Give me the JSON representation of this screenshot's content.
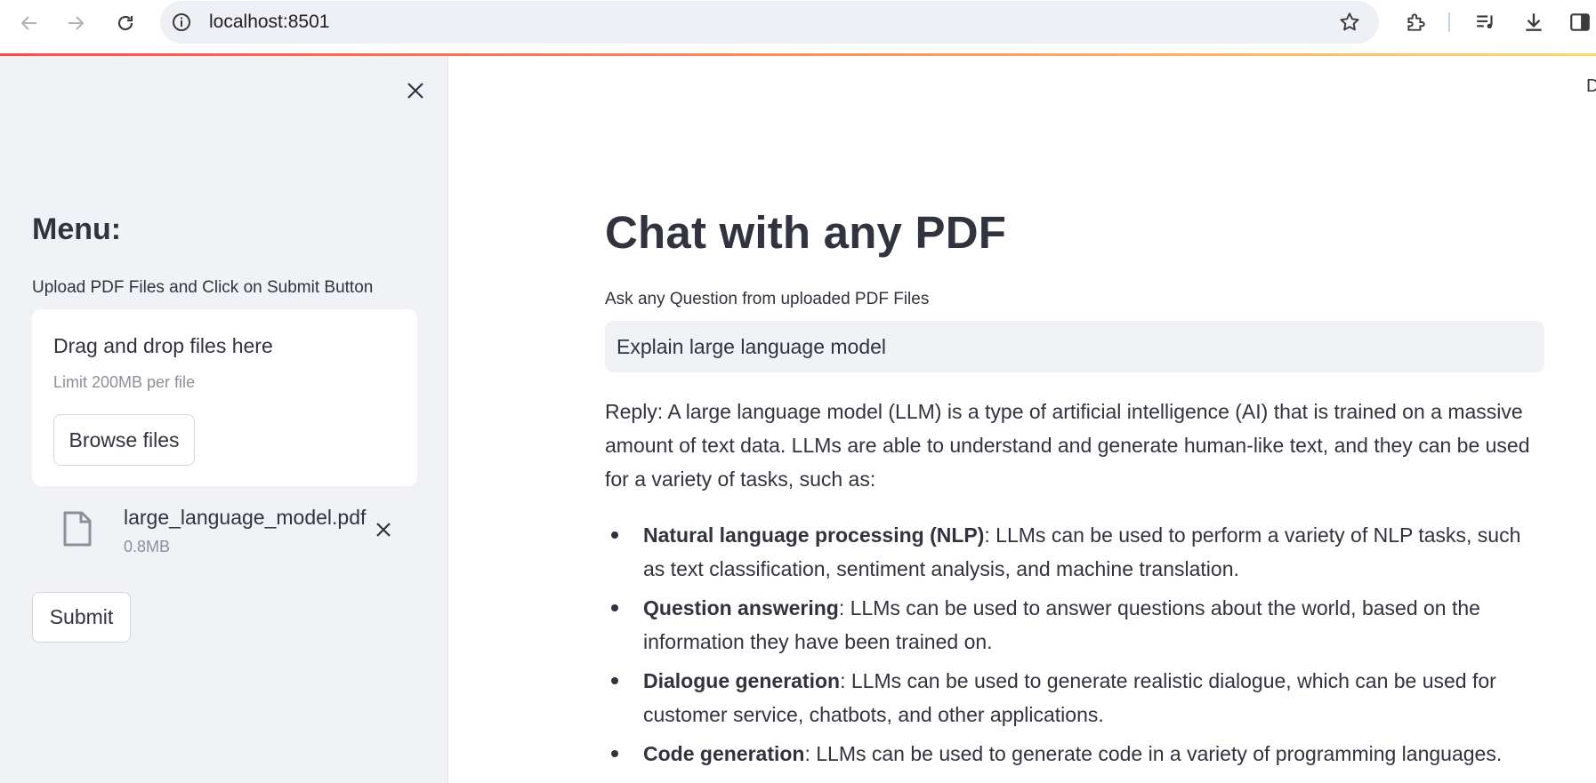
{
  "browser": {
    "url": "localhost:8501",
    "icons": [
      "back-icon",
      "forward-icon",
      "reload-icon",
      "site-info-icon",
      "bookmark-star-icon",
      "extensions-icon",
      "media-queue-icon",
      "download-icon",
      "side-panel-icon"
    ]
  },
  "sidebar": {
    "title": "Menu:",
    "upload_label": "Upload PDF Files and Click on Submit Button",
    "dropzone": {
      "title": "Drag and drop files here",
      "limit": "Limit 200MB per file",
      "browse_label": "Browse files"
    },
    "file": {
      "name": "large_language_model.pdf",
      "size": "0.8MB"
    },
    "submit_label": "Submit"
  },
  "main": {
    "corner_text": "D",
    "title": "Chat with any PDF",
    "question_label": "Ask any Question from uploaded PDF Files",
    "question_value": "Explain large language model",
    "reply": "Reply: A large language model (LLM) is a type of artificial intelligence (AI) that is trained on a massive amount of text data. LLMs are able to understand and generate human-like text, and they can be used for a variety of tasks, such as:",
    "bullets": [
      {
        "term": "Natural language processing (NLP)",
        "text": ": LLMs can be used to perform a variety of NLP tasks, such as text classification, sentiment analysis, and machine translation."
      },
      {
        "term": "Question answering",
        "text": ": LLMs can be used to answer questions about the world, based on the information they have been trained on."
      },
      {
        "term": "Dialogue generation",
        "text": ": LLMs can be used to generate realistic dialogue, which can be used for customer service, chatbots, and other applications."
      },
      {
        "term": "Code generation",
        "text": ": LLMs can be used to generate code in a variety of programming languages."
      }
    ]
  },
  "colors": {
    "sidebar_bg": "#f0f2f6",
    "text": "#31333f",
    "muted": "#8d9099",
    "input_bg": "#f0f2f6",
    "accent_red": "#ff4b4b"
  }
}
